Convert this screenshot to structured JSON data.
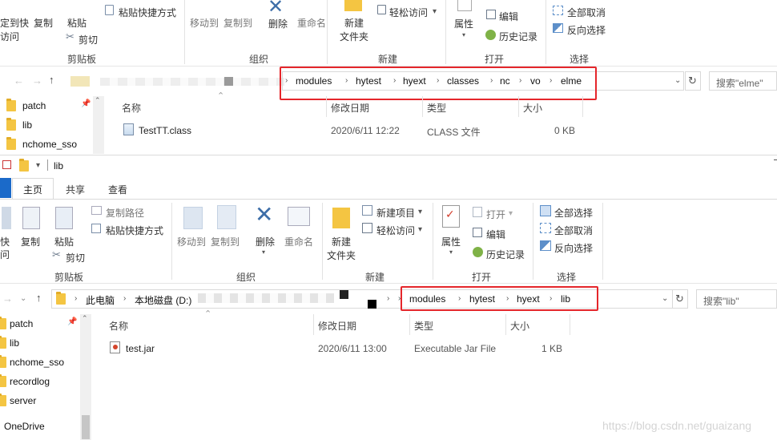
{
  "top": {
    "ribbon": {
      "pin_label_1": "定到快",
      "pin_label_2": "访问",
      "copy_label": "复制",
      "paste_label": "粘贴",
      "paste_shortcut_label": "粘贴快捷方式",
      "cut_label": "剪切",
      "move_to_label": "移动到",
      "copy_to_label": "复制到",
      "delete_label": "删除",
      "rename_label": "重命名",
      "new_folder_label_1": "新建",
      "new_folder_label_2": "文件夹",
      "easy_access_label": "轻松访问",
      "properties_label": "属性",
      "edit_label": "编辑",
      "history_label": "历史记录",
      "select_none_label": "全部取消",
      "invert_selection_label": "反向选择",
      "groups": {
        "clipboard": "剪贴板",
        "organize": "组织",
        "new": "新建",
        "open": "打开",
        "select": "选择"
      }
    },
    "breadcrumb": [
      "modules",
      "hytest",
      "hyext",
      "classes",
      "nc",
      "vo",
      "elme"
    ],
    "search_placeholder": "搜索\"elme\"",
    "nav": [
      "patch",
      "lib",
      "nchome_sso"
    ],
    "columns": {
      "name": "名称",
      "modified": "修改日期",
      "type": "类型",
      "size": "大小"
    },
    "files": [
      {
        "name": "TestTT.class",
        "modified": "2020/6/11 12:22",
        "type": "CLASS 文件",
        "size": "0 KB"
      }
    ]
  },
  "bottom": {
    "title": "lib",
    "tabs": {
      "home": "主页",
      "share": "共享",
      "view": "查看"
    },
    "ribbon": {
      "pin_label_1": "快",
      "pin_label_2": "问",
      "copy_label": "复制",
      "paste_label": "粘贴",
      "copy_path_label": "复制路径",
      "paste_shortcut_label": "粘贴快捷方式",
      "cut_label": "剪切",
      "move_to_label": "移动到",
      "copy_to_label": "复制到",
      "delete_label": "删除",
      "rename_label": "重命名",
      "new_folder_label_1": "新建",
      "new_folder_label_2": "文件夹",
      "new_item_label": "新建项目",
      "easy_access_label": "轻松访问",
      "properties_label": "属性",
      "open_label": "打开",
      "edit_label": "编辑",
      "history_label": "历史记录",
      "select_all_label": "全部选择",
      "select_none_label": "全部取消",
      "invert_selection_label": "反向选择",
      "groups": {
        "clipboard": "剪贴板",
        "organize": "组织",
        "new": "新建",
        "open": "打开",
        "select": "选择"
      }
    },
    "breadcrumb_prefix": [
      "此电脑",
      "本地磁盘 (D:)"
    ],
    "breadcrumb": [
      "modules",
      "hytest",
      "hyext",
      "lib"
    ],
    "search_placeholder": "搜索\"lib\"",
    "nav": [
      "patch",
      "lib",
      "nchome_sso",
      "recordlog",
      "server",
      "OneDrive"
    ],
    "columns": {
      "name": "名称",
      "modified": "修改日期",
      "type": "类型",
      "size": "大小"
    },
    "files": [
      {
        "name": "test.jar",
        "modified": "2020/6/11 13:00",
        "type": "Executable Jar File",
        "size": "1 KB"
      }
    ]
  },
  "watermark": "https://blog.csdn.net/guaizang",
  "colors": {
    "highlight_box": "#e5262b",
    "tab_active_border": "#1b6ac9",
    "folder": "#f4c542"
  }
}
